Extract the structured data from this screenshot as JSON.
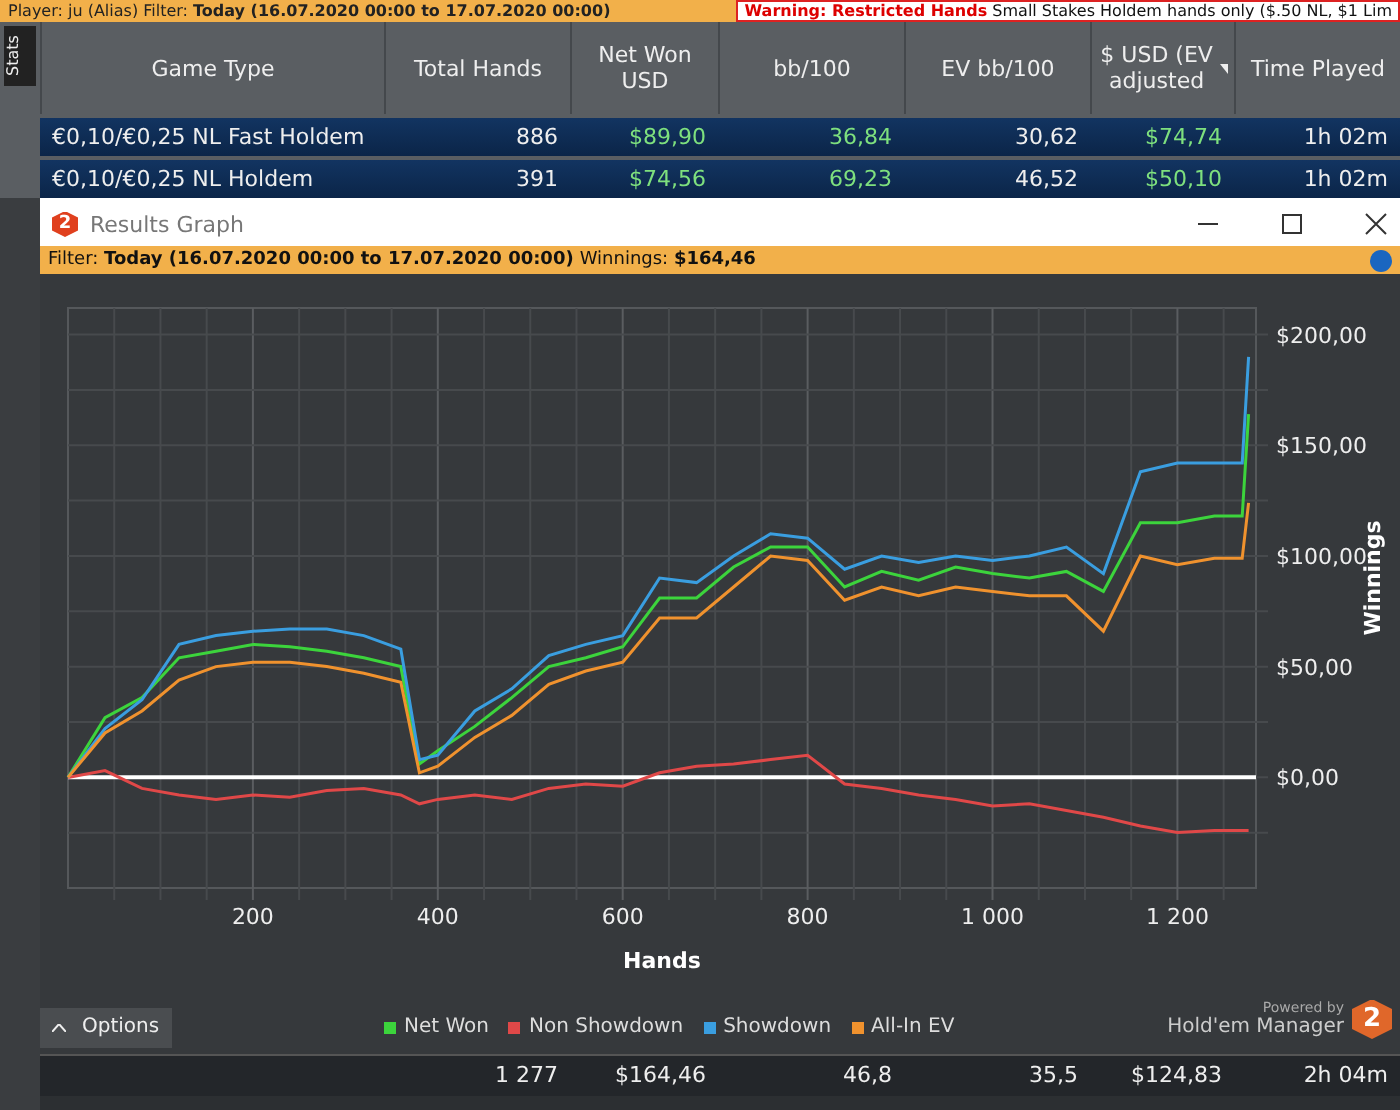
{
  "top_strip": {
    "player": "Player: ju (Alias)",
    "filter_label": "Filter:",
    "filter": "Today (16.07.2020 00:00 to 17.07.2020 00:00)",
    "warning_title": "Warning: Restricted Hands",
    "warning_text": "Small Stakes Holdem hands only ($.50 NL, $1 Lim"
  },
  "side_tab": "Stats",
  "table": {
    "columns": [
      {
        "label": "Game Type",
        "positive": false,
        "menu": false
      },
      {
        "label": "Total Hands",
        "positive": false,
        "menu": false
      },
      {
        "label": "Net Won USD",
        "positive": true,
        "menu": false
      },
      {
        "label": "bb/100",
        "positive": true,
        "menu": false
      },
      {
        "label": "EV bb/100",
        "positive": false,
        "menu": false
      },
      {
        "label": "$ USD (EV adjusted",
        "positive": true,
        "menu": true
      },
      {
        "label": "Time Played",
        "positive": false,
        "menu": false
      }
    ],
    "rows": [
      {
        "cells": [
          "€0,10/€0,25 NL Fast Holdem",
          "886",
          "$89,90",
          "36,84",
          "30,62",
          "$74,74",
          "1h 02m"
        ]
      },
      {
        "cells": [
          "€0,10/€0,25 NL Holdem",
          "391",
          "$74,56",
          "69,23",
          "46,52",
          "$50,10",
          "1h 02m"
        ]
      }
    ],
    "summary": [
      "1 277",
      "$164,46",
      "46,8",
      "35,5",
      "$124,83",
      "2h 04m"
    ]
  },
  "window": {
    "logo": "2",
    "title": "Results Graph"
  },
  "filter_bar": {
    "label": "Filter:",
    "value": "Today (16.07.2020 00:00 to 17.07.2020 00:00)",
    "winnings_label": "Winnings:",
    "winnings": "$164,46"
  },
  "graph": {
    "chart_data": {
      "type": "line",
      "grid": true,
      "xlabel": "Hands",
      "ylabel": "Winnings",
      "x": [
        0,
        40,
        80,
        120,
        160,
        200,
        240,
        280,
        320,
        360,
        380,
        400,
        440,
        480,
        520,
        560,
        600,
        640,
        680,
        720,
        760,
        800,
        840,
        880,
        920,
        960,
        1000,
        1040,
        1080,
        1120,
        1160,
        1200,
        1240,
        1270,
        1277
      ],
      "series": [
        {
          "name": "Net Won",
          "color": "#3cd43c",
          "values": [
            0,
            27,
            36,
            54,
            57,
            60,
            59,
            57,
            54,
            50,
            6,
            12,
            23,
            36,
            50,
            54,
            59,
            81,
            81,
            95,
            104,
            104,
            86,
            93,
            89,
            95,
            92,
            90,
            93,
            84,
            115,
            115,
            118,
            118,
            164
          ]
        },
        {
          "name": "Non Showdown",
          "color": "#e04848",
          "values": [
            0,
            3,
            -5,
            -8,
            -10,
            -8,
            -9,
            -6,
            -5,
            -8,
            -12,
            -10,
            -8,
            -10,
            -5,
            -3,
            -4,
            2,
            5,
            6,
            8,
            10,
            -3,
            -5,
            -8,
            -10,
            -13,
            -12,
            -15,
            -18,
            -22,
            -25,
            -24,
            -24,
            -24
          ]
        },
        {
          "name": "Showdown",
          "color": "#3a9ee0",
          "values": [
            0,
            22,
            35,
            60,
            64,
            66,
            67,
            67,
            64,
            58,
            8,
            10,
            30,
            40,
            55,
            60,
            64,
            90,
            88,
            100,
            110,
            108,
            94,
            100,
            97,
            100,
            98,
            100,
            104,
            92,
            138,
            142,
            142,
            142,
            190
          ]
        },
        {
          "name": "All-In EV",
          "color": "#f0922e",
          "values": [
            0,
            20,
            30,
            44,
            50,
            52,
            52,
            50,
            47,
            43,
            2,
            5,
            18,
            28,
            42,
            48,
            52,
            72,
            72,
            86,
            100,
            98,
            80,
            86,
            82,
            86,
            84,
            82,
            82,
            66,
            100,
            96,
            99,
            99,
            124
          ]
        }
      ],
      "xlim": [
        0,
        1285
      ],
      "ylim": [
        -50,
        212
      ],
      "xticks": [
        {
          "value": 200,
          "label": "200"
        },
        {
          "value": 400,
          "label": "400"
        },
        {
          "value": 600,
          "label": "600"
        },
        {
          "value": 800,
          "label": "800"
        },
        {
          "value": 1000,
          "label": "1 000"
        },
        {
          "value": 1200,
          "label": "1 200"
        }
      ],
      "yticks": [
        {
          "value": 0,
          "label": "$0,00"
        },
        {
          "value": 50,
          "label": "$50,00"
        },
        {
          "value": 100,
          "label": "$100,00"
        },
        {
          "value": 150,
          "label": "$150,00"
        },
        {
          "value": 200,
          "label": "$200,00"
        }
      ]
    }
  },
  "options_button": "Options",
  "powered_by": {
    "caption": "Powered by",
    "product": "Hold'em Manager",
    "badge": "2"
  }
}
